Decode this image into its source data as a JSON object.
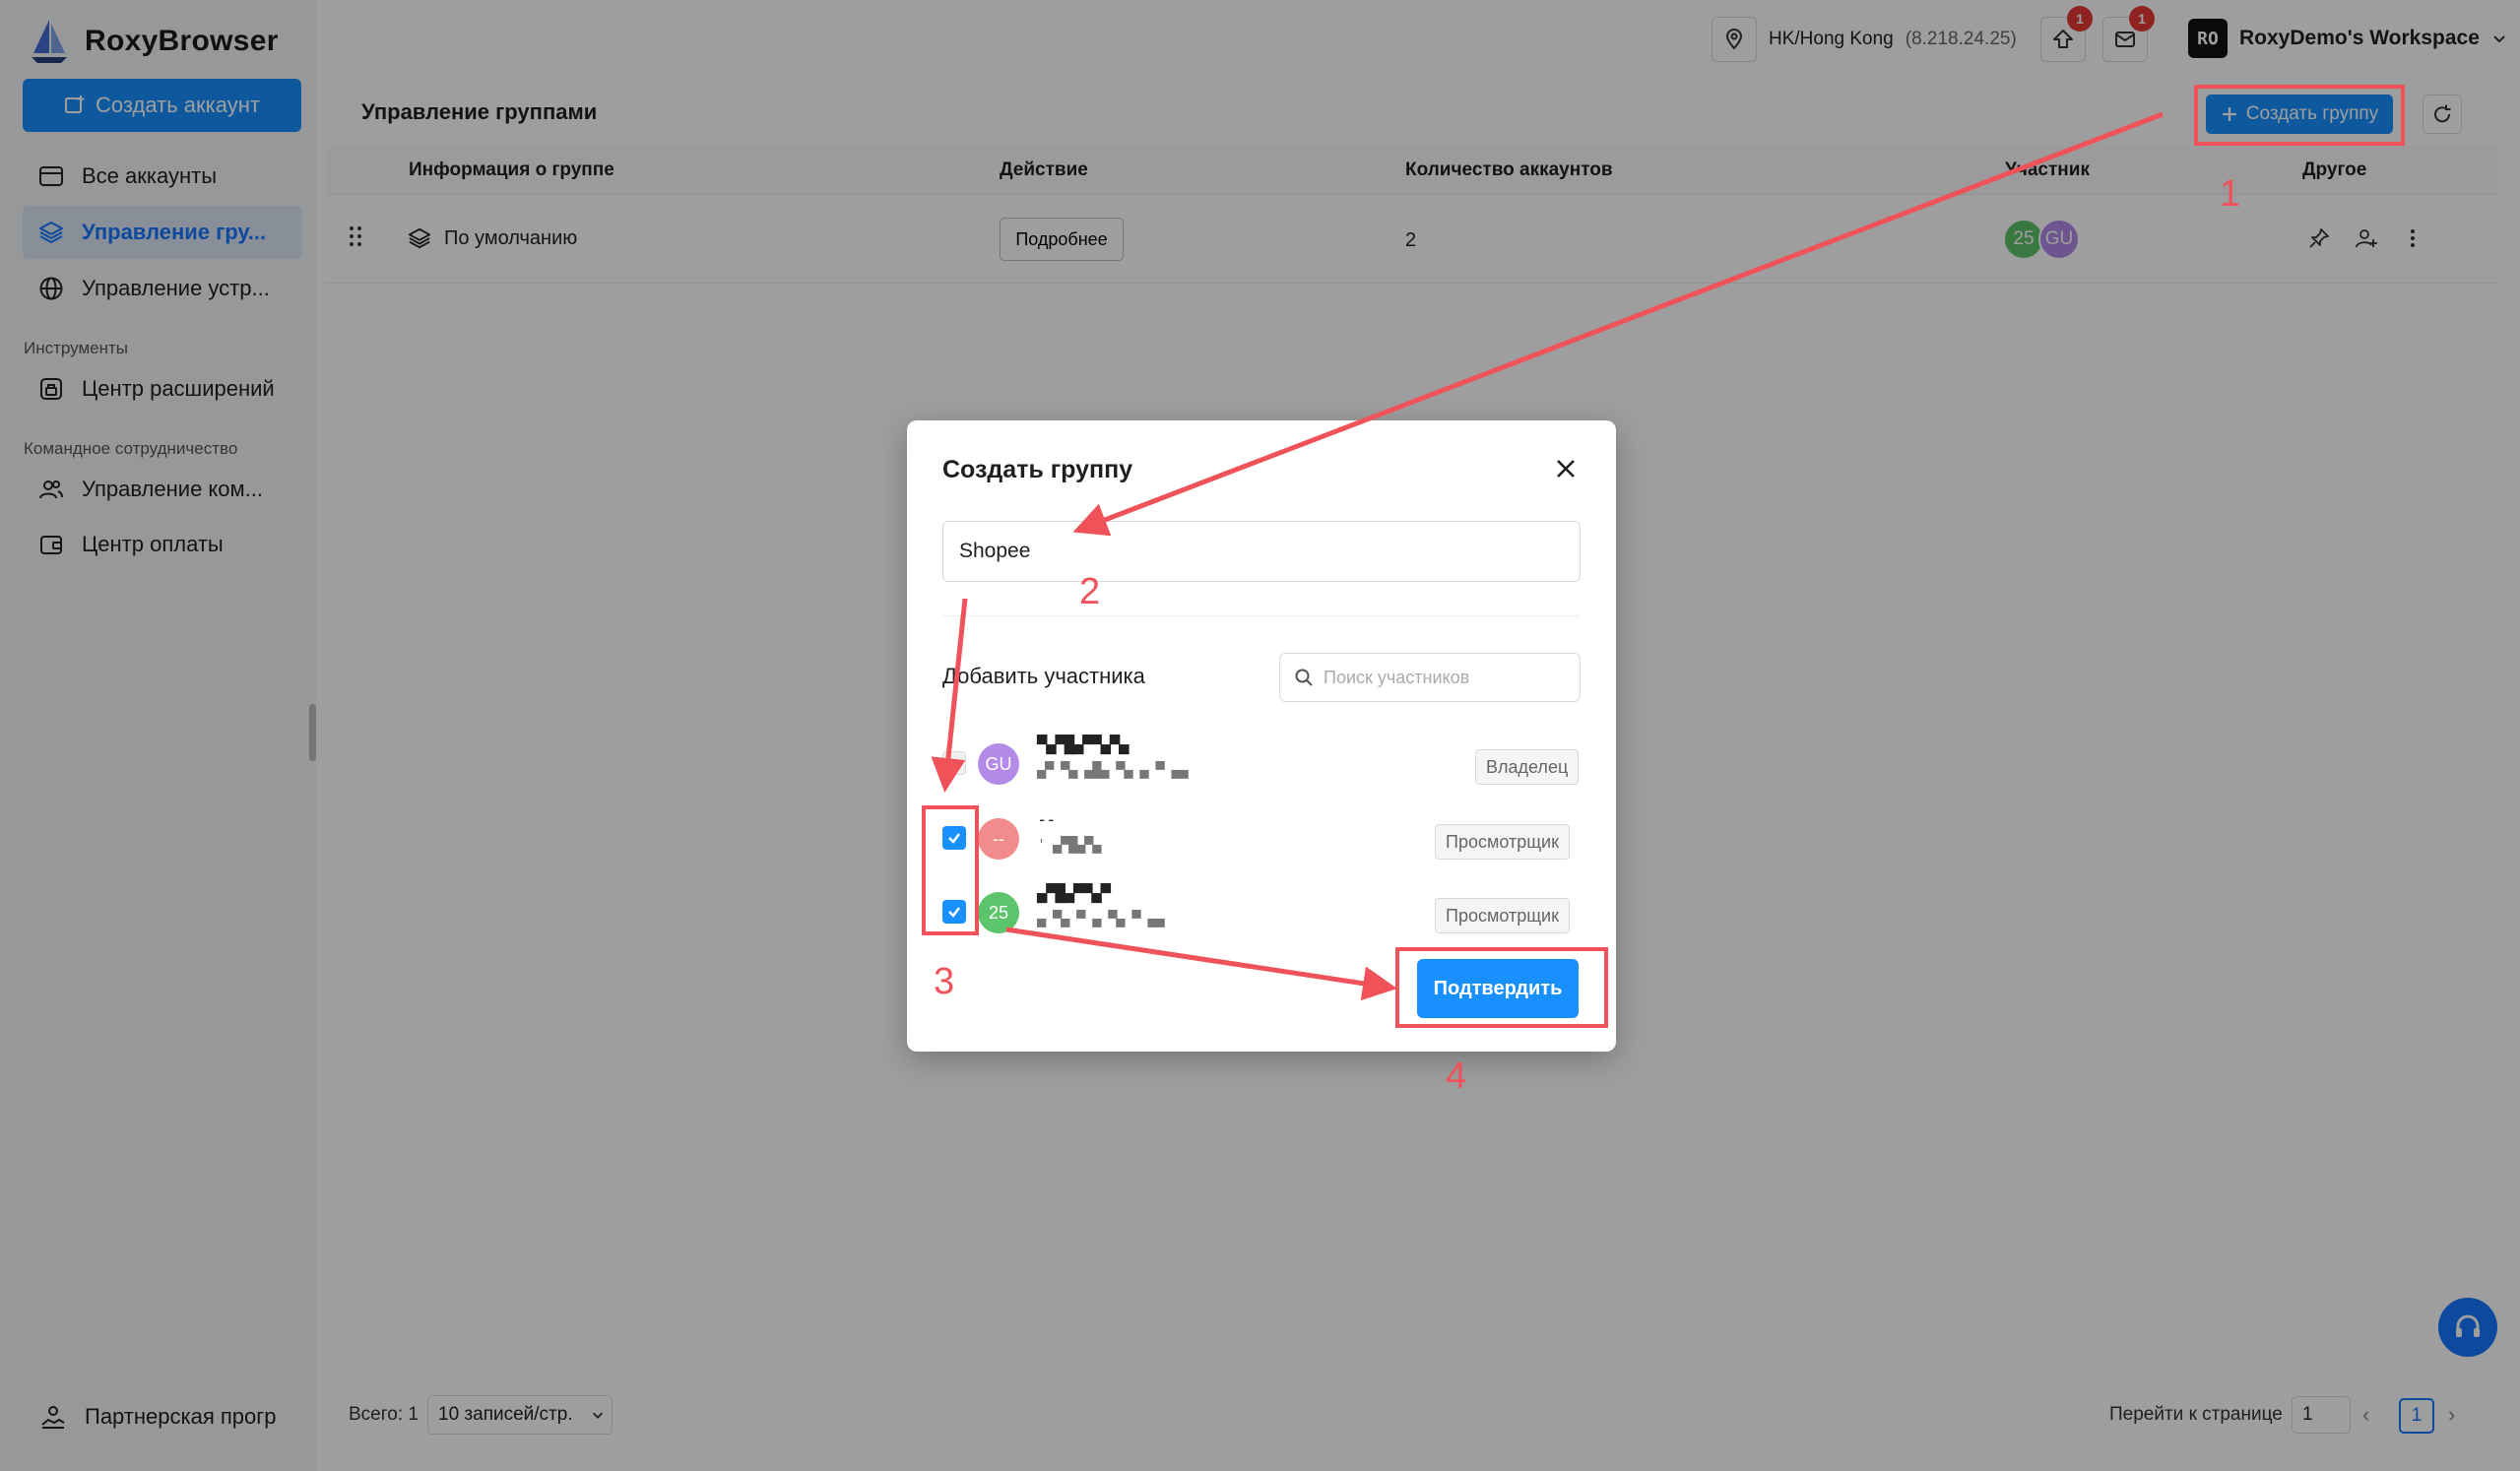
{
  "app": {
    "name": "RoxyBrowser"
  },
  "colors": {
    "primary": "#1890ff",
    "annotation": "#f0525a",
    "badge": "#e53935",
    "avatar_green": "#5cc46a",
    "avatar_purple": "#b48ae8",
    "avatar_red": "#f28b8b"
  },
  "sidebar": {
    "create_account": "Создать аккаунт",
    "items": [
      {
        "label": "Все аккаунты",
        "icon": "window-icon"
      },
      {
        "label": "Управление гру...",
        "icon": "layers-icon"
      },
      {
        "label": "Управление устр...",
        "icon": "globe-icon"
      }
    ],
    "section_tools": "Инструменты",
    "tools_items": [
      {
        "label": "Центр расширений",
        "icon": "extension-icon"
      }
    ],
    "section_team": "Командное сотрудничество",
    "team_items": [
      {
        "label": "Управление ком...",
        "icon": "users-icon"
      },
      {
        "label": "Центр оплаты",
        "icon": "wallet-icon"
      }
    ],
    "partner": "Партнерская прогр"
  },
  "topbar": {
    "location": "HK/Hong Kong",
    "ip": "(8.218.24.25)",
    "upload_badge": "1",
    "mail_badge": "1",
    "workspace_avatar": "RO",
    "workspace_name": "RoxyDemo's Workspace"
  },
  "page": {
    "title": "Управление группами",
    "create_group": "Создать группу"
  },
  "table": {
    "columns": [
      "Информация о группе",
      "Действие",
      "Количество аккаунтов",
      "Участник",
      "Другое"
    ],
    "rows": [
      {
        "name": "По умолчанию",
        "action": "Подробнее",
        "count": "2",
        "members": [
          "25",
          "GU"
        ]
      }
    ]
  },
  "footer": {
    "total": "Всего: 1",
    "page_size": "10 записей/стр.",
    "goto_label": "Перейти к странице",
    "goto_value": "1",
    "current_page": "1"
  },
  "modal": {
    "title": "Создать группу",
    "group_name_value": "Shopee",
    "add_member_label": "Добавить участника",
    "search_placeholder": "Поиск участников",
    "members": [
      {
        "avatar": "GU",
        "name": "▀▄▀█▄▀▀▄▀▄",
        "email": "▄▀ ▀▄ ▄█▄ ▀▄ ▄ ▀ ▄▄",
        "role": "Владелец",
        "checked": false
      },
      {
        "avatar": "--",
        "name": "--",
        "email": "' ▄▀█▄▀▄",
        "role": "Просмотрщик",
        "checked": true
      },
      {
        "avatar": "25",
        "name": "▄▀█▄▀▀▄▀",
        "email": "▄ ▀▄ ▀ ▄ ▀▄ ▀ ▄▄",
        "role": "Просмотрщик",
        "checked": true
      }
    ],
    "confirm": "Подтвердить"
  },
  "annotations": {
    "n1": "1",
    "n2": "2",
    "n3": "3",
    "n4": "4"
  }
}
